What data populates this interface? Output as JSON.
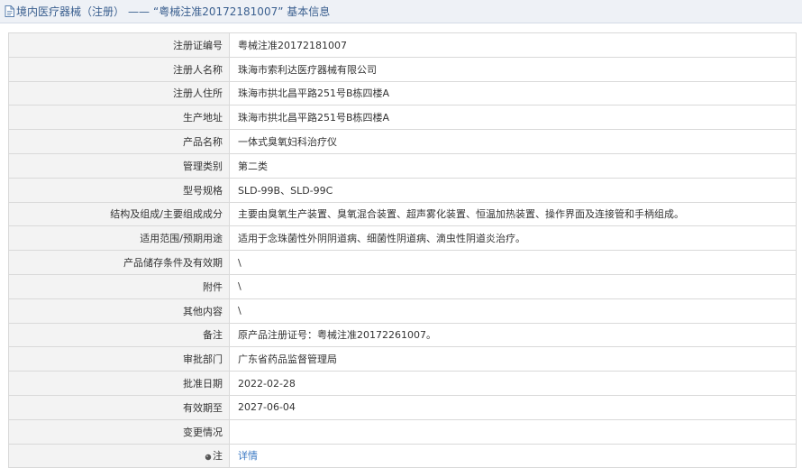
{
  "header": {
    "icon": "document-icon",
    "category": "境内医疗器械（注册）",
    "separator": "——",
    "title": "“粤械注准20172181007” 基本信息"
  },
  "rows": [
    {
      "label": "注册证编号",
      "value": "粤械注准20172181007"
    },
    {
      "label": "注册人名称",
      "value": "珠海市索利达医疗器械有限公司"
    },
    {
      "label": "注册人住所",
      "value": "珠海市拱北昌平路251号B栋四楼A"
    },
    {
      "label": "生产地址",
      "value": "珠海市拱北昌平路251号B栋四楼A"
    },
    {
      "label": "产品名称",
      "value": "一体式臭氧妇科治疗仪"
    },
    {
      "label": "管理类别",
      "value": "第二类"
    },
    {
      "label": "型号规格",
      "value": "SLD-99B、SLD-99C"
    },
    {
      "label": "结构及组成/主要组成成分",
      "value": "主要由臭氧生产装置、臭氧混合装置、超声雾化装置、恒温加热装置、操作界面及连接管和手柄组成。"
    },
    {
      "label": "适用范围/预期用途",
      "value": "适用于念珠菌性外阴阴道病、细菌性阴道病、滴虫性阴道炎治疗。"
    },
    {
      "label": "产品储存条件及有效期",
      "value": "\\"
    },
    {
      "label": "附件",
      "value": "\\"
    },
    {
      "label": "其他内容",
      "value": "\\"
    },
    {
      "label": "备注",
      "value": "原产品注册证号：粤械注准20172261007。"
    },
    {
      "label": "审批部门",
      "value": "广东省药品监督管理局"
    },
    {
      "label": "批准日期",
      "value": "2022-02-28"
    },
    {
      "label": "有效期至",
      "value": "2027-06-04"
    },
    {
      "label": "变更情况",
      "value": ""
    }
  ],
  "note_row": {
    "icon": "pin-icon",
    "label": "注",
    "link_text": "详情",
    "link_color": "#3a78c3"
  },
  "colors": {
    "label_bg": "#f3f3f3",
    "border": "#d9d9d9",
    "header_bg": "#eef1f6",
    "header_text": "#3a5f8f"
  }
}
